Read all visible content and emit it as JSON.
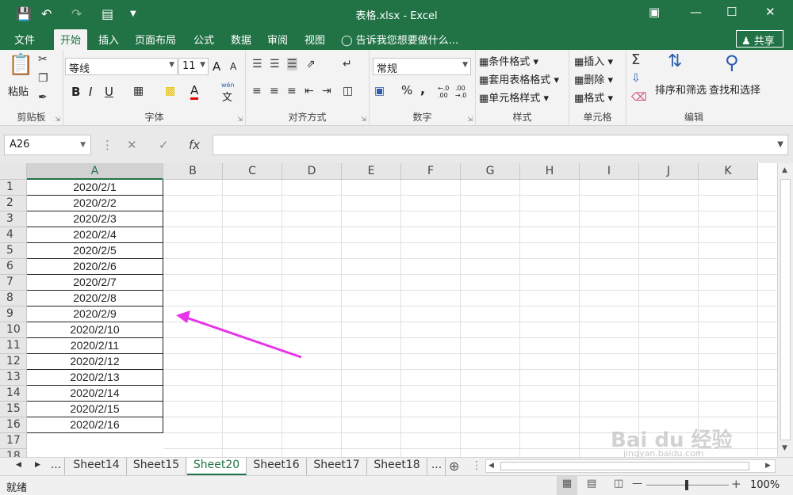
{
  "window": {
    "title": "表格.xlsx - Excel"
  },
  "ribbon_tabs": [
    "文件",
    "开始",
    "插入",
    "页面布局",
    "公式",
    "数据",
    "审阅",
    "视图"
  ],
  "tell_me": "告诉我您想要做什么...",
  "share_label": "共享",
  "clipboard": {
    "paste": "粘贴",
    "group": "剪贴板"
  },
  "font": {
    "name": "等线",
    "size": "11",
    "group": "字体",
    "bold": "B",
    "italic": "I",
    "underline": "U",
    "grow": "A",
    "shrink": "A",
    "color_letter": "A",
    "phonetic_top": "wén",
    "phonetic": "文"
  },
  "alignment": {
    "group": "对齐方式"
  },
  "number": {
    "format": "常规",
    "group": "数字",
    "percent": "%",
    "comma": ",",
    "inc": "←.0 .00",
    "dec": ".00 →.0"
  },
  "styles": {
    "conditional": "条件格式",
    "table": "套用表格格式",
    "cell": "单元格样式",
    "group": "样式"
  },
  "cells": {
    "insert": "插入",
    "delete": "删除",
    "format": "格式",
    "group": "单元格"
  },
  "editing": {
    "sort": "排序和筛选",
    "find": "查找和选择",
    "group": "编辑"
  },
  "formula_bar": {
    "name_box": "A26",
    "fx": "fx",
    "value": ""
  },
  "columns": [
    "A",
    "B",
    "C",
    "D",
    "E",
    "F",
    "G",
    "H",
    "I",
    "J",
    "K"
  ],
  "rows": [
    1,
    2,
    3,
    4,
    5,
    6,
    7,
    8,
    9,
    10,
    11,
    12,
    13,
    14,
    15,
    16,
    17,
    18
  ],
  "cells_a": [
    "2020/2/1",
    "2020/2/2",
    "2020/2/3",
    "2020/2/4",
    "2020/2/5",
    "2020/2/6",
    "2020/2/7",
    "2020/2/8",
    "2020/2/9",
    "2020/2/10",
    "2020/2/11",
    "2020/2/12",
    "2020/2/13",
    "2020/2/14",
    "2020/2/15",
    "2020/2/16"
  ],
  "sheets": [
    "...",
    "Sheet14",
    "Sheet15",
    "Sheet20",
    "Sheet16",
    "Sheet17",
    "Sheet18",
    "..."
  ],
  "active_sheet": "Sheet20",
  "status": {
    "ready": "就绪",
    "zoom": "100%"
  },
  "watermark": {
    "brand": "Bai du 经验",
    "url": "jingyan.baidu.com"
  },
  "colors": {
    "excel_green": "#217346",
    "arrow": "#e833e8"
  }
}
